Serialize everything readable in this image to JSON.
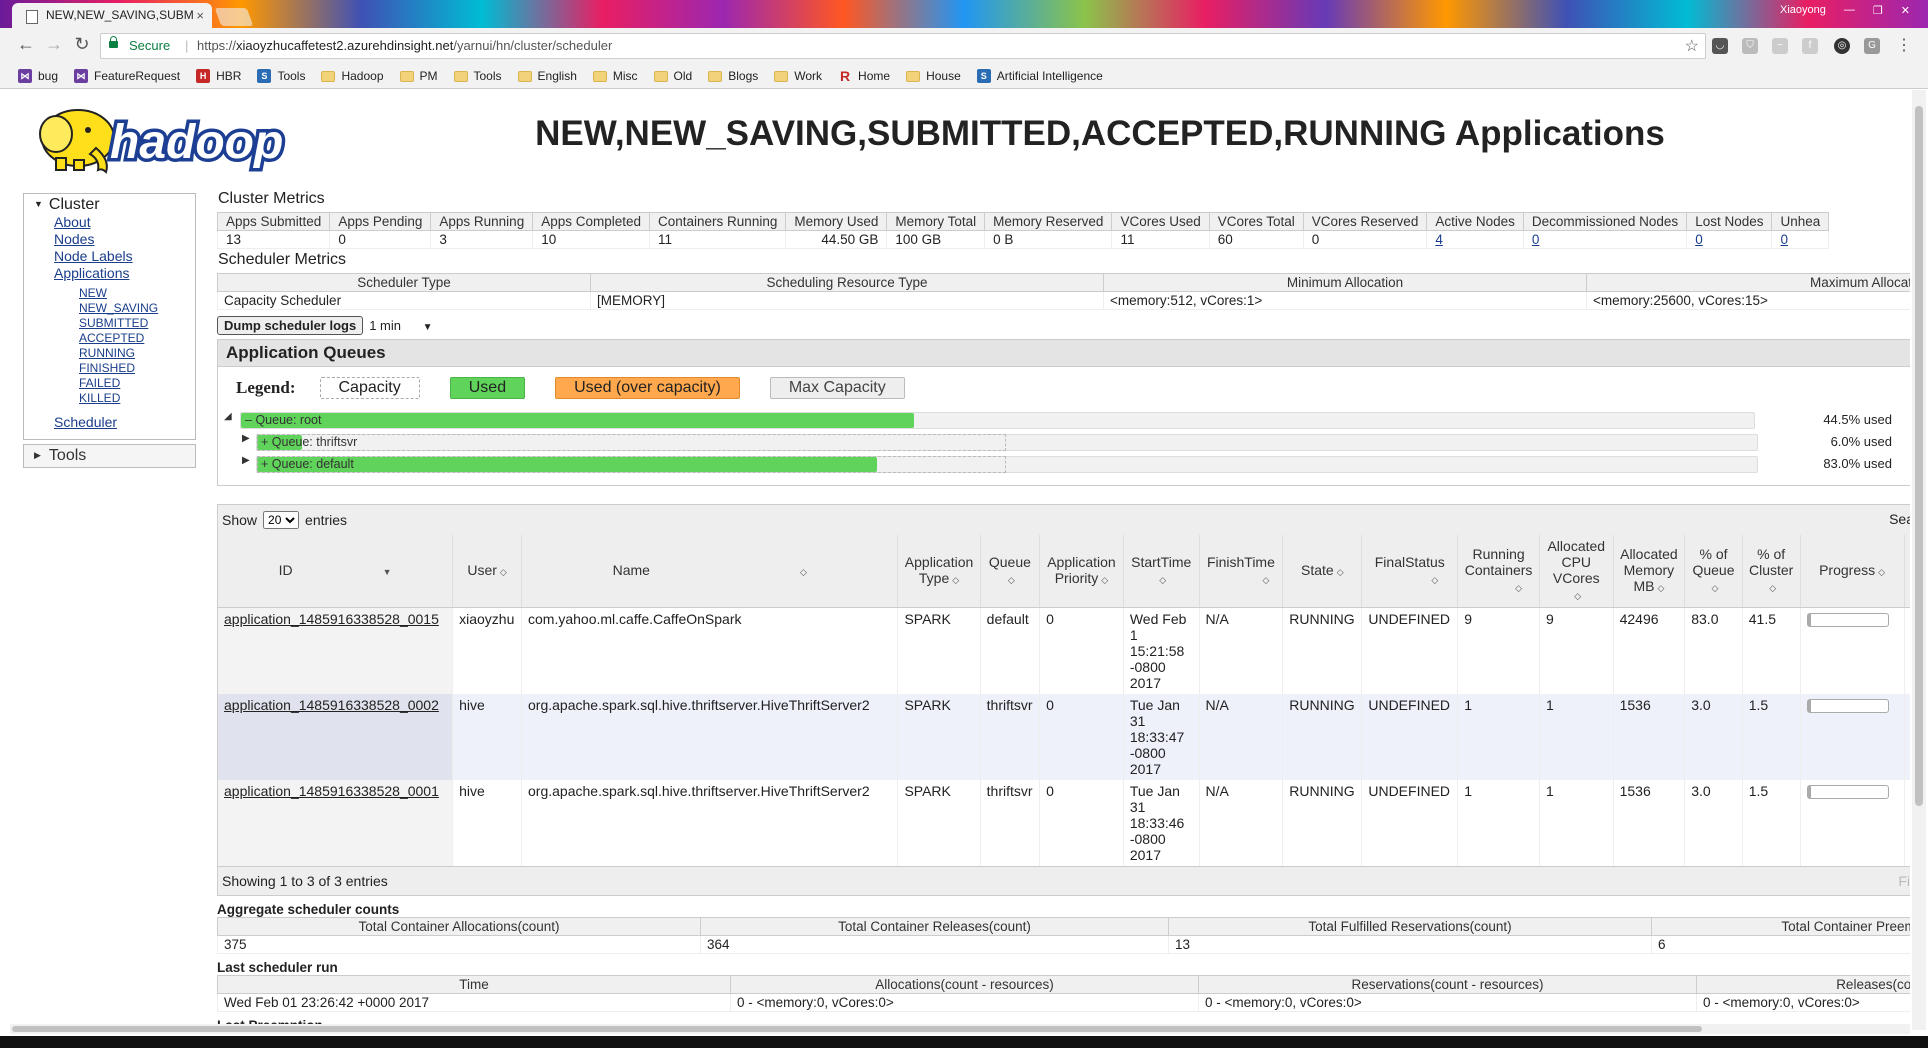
{
  "browser": {
    "tab_title": "NEW,NEW_SAVING,SUBM",
    "user": "Xiaoyong",
    "secure_label": "Secure",
    "url_prefix": "https://",
    "url_host": "xiaoyzhucaffetest2.azurehdinsight.net",
    "url_path": "/yarnui/hn/cluster/scheduler",
    "bookmarks": [
      "bug",
      "FeatureRequest",
      "HBR",
      "Tools",
      "Hadoop",
      "PM",
      "Tools",
      "English",
      "Misc",
      "Old",
      "Blogs",
      "Work",
      "Home",
      "House",
      "Artificial Intelligence"
    ]
  },
  "logo_text": "hadoop",
  "page_title": "NEW,NEW_SAVING,SUBMITTED,ACCEPTED,RUNNING Applications",
  "sidebar": {
    "cluster_label": "Cluster",
    "links": [
      "About",
      "Nodes",
      "Node Labels",
      "Applications"
    ],
    "app_states": [
      "NEW",
      "NEW_SAVING",
      "SUBMITTED",
      "ACCEPTED",
      "RUNNING",
      "FINISHED",
      "FAILED",
      "KILLED"
    ],
    "scheduler_label": "Scheduler",
    "tools_label": "Tools"
  },
  "cluster_metrics": {
    "title": "Cluster Metrics",
    "headers": [
      "Apps Submitted",
      "Apps Pending",
      "Apps Running",
      "Apps Completed",
      "Containers Running",
      "Memory Used",
      "Memory Total",
      "Memory Reserved",
      "VCores Used",
      "VCores Total",
      "VCores Reserved",
      "Active Nodes",
      "Decommissioned Nodes",
      "Lost Nodes",
      "Unhea"
    ],
    "values": [
      "13",
      "0",
      "3",
      "10",
      "11",
      "44.50 GB",
      "100 GB",
      "0 B",
      "11",
      "60",
      "0",
      "4",
      "0",
      "0",
      "0"
    ]
  },
  "scheduler_metrics": {
    "title": "Scheduler Metrics",
    "headers": [
      "Scheduler Type",
      "Scheduling Resource Type",
      "Minimum Allocation",
      "Maximum Allocation"
    ],
    "values": [
      "Capacity Scheduler",
      "[MEMORY]",
      "<memory:512, vCores:1>",
      "<memory:25600, vCores:15>"
    ]
  },
  "dump_logs_label": "Dump scheduler logs",
  "dump_interval": "1 min",
  "queues": {
    "title": "Application Queues",
    "legend_title": "Legend:",
    "legend": [
      "Capacity",
      "Used",
      "Used (over capacity)",
      "Max Capacity"
    ],
    "rows": [
      {
        "label": "Queue: root",
        "used_fraction": 0.445,
        "pct_text": "44.5% used"
      },
      {
        "label": "Queue: thriftsvr",
        "used_fraction": 0.06,
        "pct_text": "6.0% used"
      },
      {
        "label": "Queue: default",
        "used_fraction": 0.83,
        "pct_text": "83.0% used"
      }
    ]
  },
  "apps_table": {
    "show_label": "Show",
    "show_value": "20",
    "entries_label": "entries",
    "search_label": "Sea",
    "headers": [
      "ID",
      "User",
      "Name",
      "Application Type",
      "Queue",
      "Application Priority",
      "StartTime",
      "FinishTime",
      "State",
      "FinalStatus",
      "Running Containers",
      "Allocated CPU VCores",
      "Allocated Memory MB",
      "% of Queue",
      "% of Cluster",
      "Progress"
    ],
    "rows": [
      {
        "id": "application_1485916338528_0015",
        "user": "xiaoyzhu",
        "name": "com.yahoo.ml.caffe.CaffeOnSpark",
        "type": "SPARK",
        "queue": "default",
        "priority": "0",
        "start": "Wed Feb 1 15:21:58 -0800 2017",
        "finish": "N/A",
        "state": "RUNNING",
        "final": "UNDEFINED",
        "containers": "9",
        "vcores": "9",
        "memory": "42496",
        "pct_queue": "83.0",
        "pct_cluster": "41.5",
        "progress": 0.0
      },
      {
        "id": "application_1485916338528_0002",
        "user": "hive",
        "name": "org.apache.spark.sql.hive.thriftserver.HiveThriftServer2",
        "type": "SPARK",
        "queue": "thriftsvr",
        "priority": "0",
        "start": "Tue Jan 31 18:33:47 -0800 2017",
        "finish": "N/A",
        "state": "RUNNING",
        "final": "UNDEFINED",
        "containers": "1",
        "vcores": "1",
        "memory": "1536",
        "pct_queue": "3.0",
        "pct_cluster": "1.5",
        "progress": 0.0
      },
      {
        "id": "application_1485916338528_0001",
        "user": "hive",
        "name": "org.apache.spark.sql.hive.thriftserver.HiveThriftServer2",
        "type": "SPARK",
        "queue": "thriftsvr",
        "priority": "0",
        "start": "Tue Jan 31 18:33:46 -0800 2017",
        "finish": "N/A",
        "state": "RUNNING",
        "final": "UNDEFINED",
        "containers": "1",
        "vcores": "1",
        "memory": "1536",
        "pct_queue": "3.0",
        "pct_cluster": "1.5",
        "progress": 0.0
      }
    ],
    "footer": "Showing 1 to 3 of 3 entries",
    "footer_right": "Fi"
  },
  "aggregate": {
    "title": "Aggregate scheduler counts",
    "headers": [
      "Total Container Allocations(count)",
      "Total Container Releases(count)",
      "Total Fulfilled Reservations(count)",
      "Total Container Preempti"
    ],
    "values": [
      "375",
      "364",
      "13",
      "6"
    ]
  },
  "last_run": {
    "title": "Last scheduler run",
    "headers": [
      "Time",
      "Allocations(count - resources)",
      "Reservations(count - resources)",
      "Releases(count"
    ],
    "values": [
      "Wed Feb 01 23:26:42 +0000 2017",
      "0 - <memory:0, vCores:0>",
      "0 - <memory:0, vCores:0>",
      "0 - <memory:0, vCores:0>"
    ]
  },
  "last_preemption": {
    "title": "Last Preemption"
  }
}
